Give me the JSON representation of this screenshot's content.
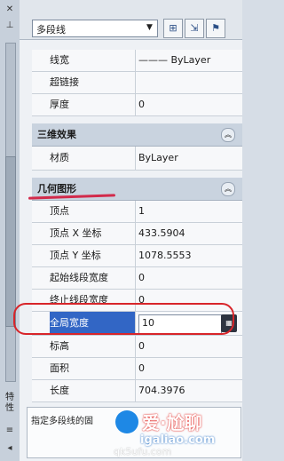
{
  "left_strip": {
    "top_icons": [
      "close-icon",
      "pin-icon"
    ],
    "vertical_label": "特性",
    "bottom_icons": [
      "menu-icon",
      "arrow-icon"
    ]
  },
  "object_type": "多段线",
  "toolbar": {
    "buttons": [
      "select-objects-icon",
      "quick-select-icon",
      "toggle-pickadd-icon"
    ]
  },
  "rows_top": [
    {
      "label": "线宽",
      "value": "——— ByLayer"
    },
    {
      "label": "超链接",
      "value": ""
    },
    {
      "label": "厚度",
      "value": "0"
    }
  ],
  "section_3d": {
    "title": "三维效果"
  },
  "rows_3d": [
    {
      "label": "材质",
      "value": "ByLayer"
    }
  ],
  "section_geom": {
    "title": "几何图形"
  },
  "rows_geom": [
    {
      "label": "顶点",
      "value": "1"
    },
    {
      "label": "顶点 X 坐标",
      "value": "433.5904"
    },
    {
      "label": "顶点 Y 坐标",
      "value": "1078.5553"
    },
    {
      "label": "起始线段宽度",
      "value": "0"
    },
    {
      "label": "终止线段宽度",
      "value": "0"
    },
    {
      "label": "全局宽度",
      "value": "10"
    },
    {
      "label": "标高",
      "value": "0"
    },
    {
      "label": "面积",
      "value": "0"
    },
    {
      "label": "长度",
      "value": "704.3976"
    }
  ],
  "status": {
    "text": "指定多段线的固"
  },
  "watermark": {
    "cn": "爱·尬聊",
    "url": "igaliao.com",
    "sub": "qk5ufu.com"
  },
  "colors": {
    "highlight": "#3266c5",
    "annotation_red": "#d8252a"
  }
}
